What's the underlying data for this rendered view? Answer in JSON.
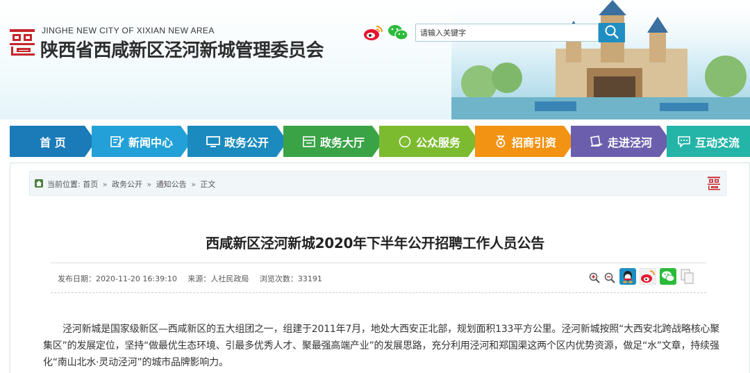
{
  "header": {
    "site_name_en": "JINGHE NEW CITY OF XIXIAN NEW AREA",
    "site_name_cn": "陕西省西咸新区泾河新城管理委员会",
    "logo_icon": "seal-logo-icon",
    "social": [
      {
        "name": "weibo",
        "icon": "weibo-icon"
      },
      {
        "name": "wechat",
        "icon": "wechat-icon"
      }
    ],
    "search": {
      "placeholder": "请输入关键字",
      "value": ""
    },
    "brand_color": "#c8252c",
    "accent_color": "#1f8ec3"
  },
  "nav": [
    {
      "label": "首 页",
      "color": "#1a7bb8",
      "icon": ""
    },
    {
      "label": "新闻中心",
      "color": "#22a0d7",
      "icon": "news-edit-icon"
    },
    {
      "label": "政务公开",
      "color": "#1b8bbf",
      "icon": "monitor-icon"
    },
    {
      "label": "政务大厅",
      "color": "#3aa346",
      "icon": "hall-window-icon"
    },
    {
      "label": "公众服务",
      "color": "#7cbb2f",
      "icon": "compass-icon"
    },
    {
      "label": "招商引资",
      "color": "#f39313",
      "icon": "medal-icon"
    },
    {
      "label": "走进泾河",
      "color": "#6b5fad",
      "icon": "book-hand-icon"
    },
    {
      "label": "互动交流",
      "color": "#24b4a8",
      "icon": "chat-bubble-icon"
    }
  ],
  "breadcrumb": {
    "prefix": "当前位置:",
    "items": [
      "首页",
      "政务公开",
      "通知公告",
      "正文"
    ],
    "separator": "»"
  },
  "article": {
    "title": "西咸新区泾河新城2020年下半年公开招聘工作人员公告",
    "date_label": "发布日期：",
    "date": "2020-11-20 16:39:10",
    "source_label": "来源：",
    "source": "人社民政局",
    "views_label": "浏览次数：",
    "views": "33191",
    "body": "泾河新城是国家级新区—西咸新区的五大组团之一，组建于2011年7月，地处大西安正北部，规划面积133平方公里。泾河新城按照“大西安北跨战略核心聚集区”的发展定位，坚持“做最优生态环境、引最多优秀人才、聚最强高端产业”的发展思路，充分利用泾河和郑国渠这两个区内优势资源，做足“水”文章，持续强化“南山北水·灵动泾河”的城市品牌影响力。"
  },
  "tools": [
    {
      "name": "zoom-in",
      "icon": "zoom-in-icon"
    },
    {
      "name": "zoom-out",
      "icon": "zoom-out-icon"
    },
    {
      "name": "share-qq",
      "icon": "qq-icon"
    },
    {
      "name": "share-weibo",
      "icon": "weibo-icon"
    },
    {
      "name": "share-wechat",
      "icon": "wechat-icon"
    },
    {
      "name": "copy",
      "icon": "copy-icon"
    }
  ]
}
